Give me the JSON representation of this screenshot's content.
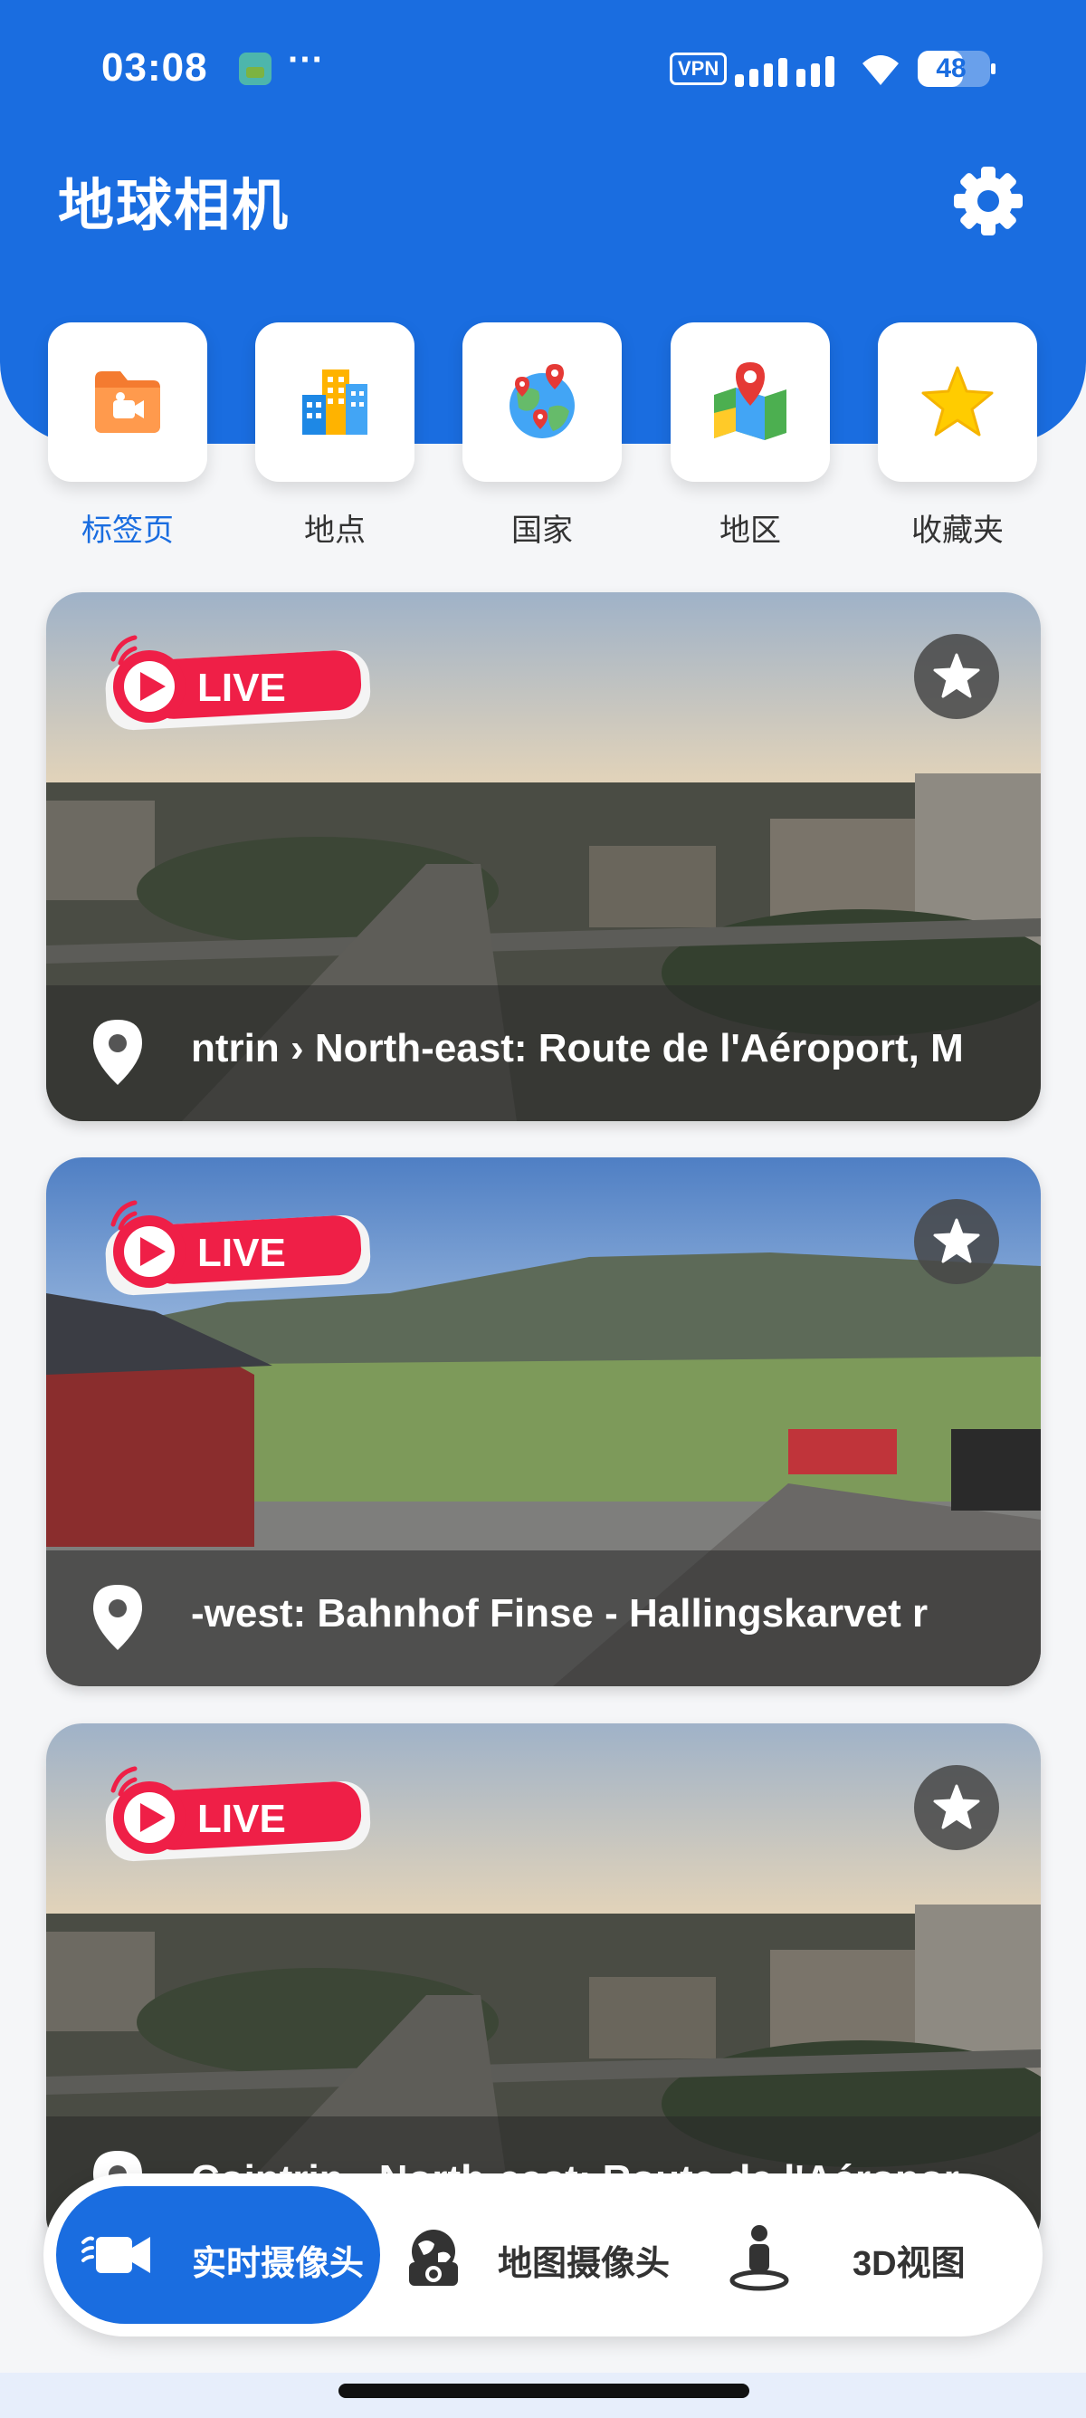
{
  "status_bar": {
    "time": "03:08",
    "dots": "···",
    "vpn": "VPN",
    "battery": "48"
  },
  "header": {
    "title": "地球相机"
  },
  "categories": [
    {
      "label": "标签页"
    },
    {
      "label": "地点"
    },
    {
      "label": "国家"
    },
    {
      "label": "地区"
    },
    {
      "label": "收藏夹"
    }
  ],
  "cameras": [
    {
      "live": "LIVE",
      "caption": "ntrin › North-east: Route de l'Aéroport, M"
    },
    {
      "live": "LIVE",
      "caption": "-west: Bahnhof Finse - Hallingskarvet r"
    },
    {
      "live": "LIVE",
      "caption": "Cointrin › North-east: Route de l'Aéropor"
    }
  ],
  "bottom_nav": {
    "live_cameras": "实时摄像头",
    "map_cameras": "地图摄像头",
    "view_3d": "3D视图"
  },
  "colors": {
    "primary": "#1a6de0",
    "live_red": "#ef1f47",
    "background": "#f5f6f8"
  }
}
